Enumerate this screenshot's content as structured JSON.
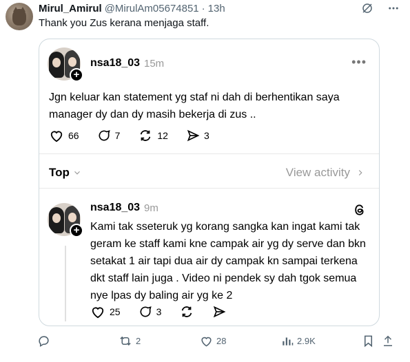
{
  "tweet": {
    "author_name": "Mirul_Amirul",
    "author_handle": "@MirulAm05674851",
    "separator": "·",
    "time": "13h",
    "text": "Thank you Zus kerana menjaga staff."
  },
  "card": {
    "post1": {
      "username": "nsa18_03",
      "time": "15m",
      "body": "Jgn keluar kan statement yg staf ni dah di berhentikan saya manager dy dan dy masih bekerja di zus ..",
      "likes": "66",
      "replies": "7",
      "reposts": "12",
      "shares": "3"
    },
    "sort": {
      "label": "Top",
      "view_activity": "View activity"
    },
    "post2": {
      "username": "nsa18_03",
      "time": "9m",
      "body": "Kami tak sseteruk yg korang sangka kan ingat kami tak geram ke staff kami kne campak air yg dy serve dan bkn setakat 1 air tapi dua air dy campak kn sampai terkena dkt staff lain juga . Video ni pendek sy dah tgok semua nye lpas dy baling air yg ke 2",
      "likes": "25",
      "replies": "3"
    }
  },
  "footer": {
    "retweets": "2",
    "likes": "28",
    "views": "2.9K"
  },
  "icons": {
    "grok": "grok-icon",
    "more": "more-icon",
    "reply": "reply-icon",
    "retweet": "retweet-icon",
    "like": "heart-icon",
    "views": "views-icon",
    "bookmark": "bookmark-icon",
    "share": "share-icon",
    "threads": "threads-logo-icon"
  }
}
